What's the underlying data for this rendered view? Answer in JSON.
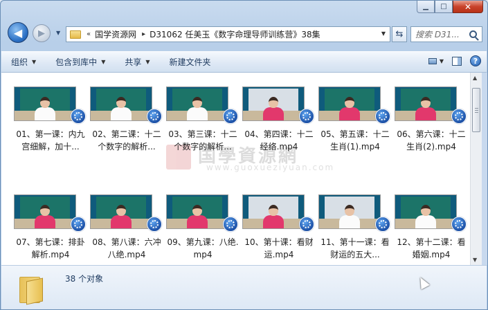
{
  "window": {
    "caption_buttons": [
      "minimize",
      "maximize",
      "close"
    ]
  },
  "address_bar": {
    "overflow_label": "«",
    "path": [
      "国学资源网",
      "D31062 任美玉《数字命理导师训练营》38集"
    ]
  },
  "search": {
    "placeholder": "搜索 D31..."
  },
  "toolbar": {
    "organize": "组织",
    "include_in_library": "包含到库中",
    "share": "共享",
    "new_folder": "新建文件夹"
  },
  "watermark": {
    "title": "国學資源網",
    "url": "www.guoxueziyuan.com"
  },
  "files": [
    {
      "name": "01、第一课：内九宫细解，加十...",
      "outfit": "white",
      "board": "dark"
    },
    {
      "name": "02、第二课：十二个数字的解析...",
      "outfit": "white",
      "board": "dark"
    },
    {
      "name": "03、第三课：十二个数字的解析...",
      "outfit": "white",
      "board": "dark"
    },
    {
      "name": "04、第四课：十二经络.mp4",
      "outfit": "pink",
      "board": "light"
    },
    {
      "name": "05、第五课：十二生肖(1).mp4",
      "outfit": "pink",
      "board": "dark"
    },
    {
      "name": "06、第六课：十二生肖(2).mp4",
      "outfit": "pink",
      "board": "dark"
    },
    {
      "name": "07、第七课：排卦解析.mp4",
      "outfit": "pink",
      "board": "dark"
    },
    {
      "name": "08、第八课：六冲八绝.mp4",
      "outfit": "pink",
      "board": "dark"
    },
    {
      "name": "09、第九课：八绝.mp4",
      "outfit": "pink",
      "board": "dark"
    },
    {
      "name": "10、第十课：看财运.mp4",
      "outfit": "pink",
      "board": "light"
    },
    {
      "name": "11、第十一课：看财运的五大...",
      "outfit": "white",
      "board": "light"
    },
    {
      "name": "12、第十二课：看婚姻.mp4",
      "outfit": "white",
      "board": "dark"
    }
  ],
  "details": {
    "count_text": "38 个对象"
  },
  "colors": {
    "window_frame": "#b8cfe9",
    "content_bg": "#ffffff",
    "board_dark": "#1c7468",
    "badge": "#1c50a6"
  }
}
